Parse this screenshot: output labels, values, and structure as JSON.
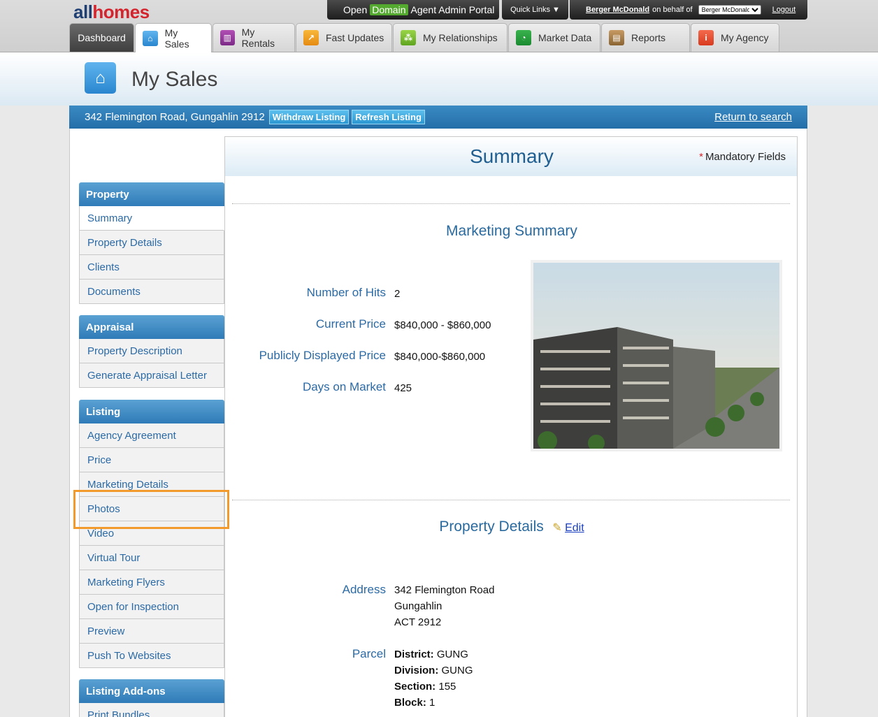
{
  "logo": {
    "part1": "all",
    "part2": "homes"
  },
  "portal": {
    "prefix": "Open",
    "brand": "Domain",
    "suffix": "Agent Admin Portal"
  },
  "quick_links": "Quick Links ▼",
  "user": {
    "name": "Berger McDonald",
    "on_behalf": "on behalf of",
    "agency_selected": "Berger McDonald",
    "logout": "Logout"
  },
  "tabs": [
    {
      "label": "Dashboard"
    },
    {
      "label": "My Sales"
    },
    {
      "label": "My Rentals"
    },
    {
      "label": "Fast Updates"
    },
    {
      "label": "My Relationships"
    },
    {
      "label": "Market Data"
    },
    {
      "label": "Reports"
    },
    {
      "label": "My Agency"
    }
  ],
  "page_title": "My Sales",
  "address_bar": {
    "address": "342 Flemington Road, Gungahlin 2912",
    "withdraw": "Withdraw Listing",
    "refresh": "Refresh Listing",
    "return": "Return to search"
  },
  "sidebar": {
    "property": {
      "title": "Property",
      "items": [
        "Summary",
        "Property Details",
        "Clients",
        "Documents"
      ]
    },
    "appraisal": {
      "title": "Appraisal",
      "items": [
        "Property Description",
        "Generate Appraisal Letter"
      ]
    },
    "listing": {
      "title": "Listing",
      "items": [
        "Agency Agreement",
        "Price",
        "Marketing Details",
        "Photos",
        "Video",
        "Virtual Tour",
        "Marketing Flyers",
        "Open for Inspection",
        "Preview",
        "Push To Websites"
      ]
    },
    "addons": {
      "title": "Listing Add-ons",
      "items": [
        "Print Bundles"
      ]
    }
  },
  "summary": {
    "title": "Summary",
    "mandatory_star": "*",
    "mandatory": "Mandatory Fields",
    "marketing_title": "Marketing Summary",
    "hits_label": "Number of Hits",
    "hits": "2",
    "current_price_label": "Current Price",
    "current_price": "$840,000 - $860,000",
    "public_price_label": "Publicly Displayed Price",
    "public_price": "$840,000-$860,000",
    "days_label": "Days on Market",
    "days": "425",
    "details_title": "Property Details",
    "edit": "Edit",
    "address_label": "Address",
    "address_lines": [
      "342 Flemington Road",
      "Gungahlin",
      "ACT 2912"
    ],
    "parcel_label": "Parcel",
    "parcel": [
      {
        "k": "District:",
        "v": "GUNG"
      },
      {
        "k": "Division:",
        "v": "GUNG"
      },
      {
        "k": "Section:",
        "v": "155"
      },
      {
        "k": "Block:",
        "v": "1"
      }
    ]
  }
}
